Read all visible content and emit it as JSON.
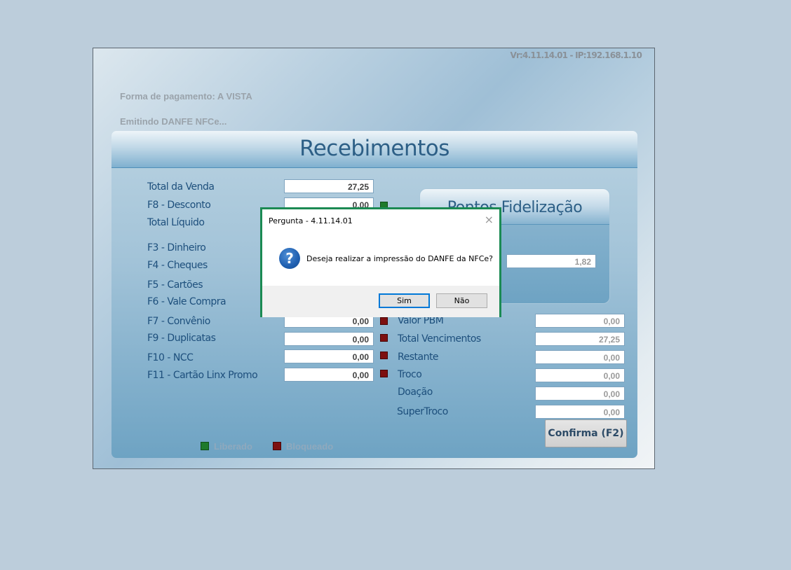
{
  "window": {
    "version": "Vr:4.11.14.01 - IP:192.168.1.10",
    "payment_method": "Forma de pagamento: A VISTA",
    "status": "Emitindo DANFE NFCe..."
  },
  "panel": {
    "title": "Recebimentos"
  },
  "left_fields": [
    {
      "label": "Total da Venda",
      "value": "27,25"
    },
    {
      "label": "F8 - Desconto",
      "value": "0,00"
    },
    {
      "label": "Total Líquido",
      "value": ""
    },
    {
      "label": "F3 - Dinheiro",
      "value": ""
    },
    {
      "label": "F4 - Cheques",
      "value": ""
    },
    {
      "label": "F5 - Cartões",
      "value": ""
    },
    {
      "label": "F6 - Vale Compra",
      "value": ""
    },
    {
      "label": "F7 - Convênio",
      "value": "0,00"
    },
    {
      "label": "F9 - Duplicatas",
      "value": "0,00"
    },
    {
      "label": "F10 - NCC",
      "value": "0,00"
    },
    {
      "label": "F11 - Cartão Linx Promo",
      "value": "0,00"
    }
  ],
  "pontos": {
    "title": "Pontos Fidelização",
    "value": "1,82"
  },
  "right_fields": [
    {
      "label": "Valor PBM",
      "value": "0,00"
    },
    {
      "label": "Total Vencimentos",
      "value": "27,25"
    },
    {
      "label": "Restante",
      "value": "0,00"
    },
    {
      "label": "Troco",
      "value": "0,00"
    },
    {
      "label": "Doação",
      "value": "0,00"
    },
    {
      "label": "SuperTroco",
      "value": "0,00"
    }
  ],
  "confirm_button": "Confirma (F2)",
  "legend": {
    "liberado": "Liberado",
    "bloqueado": "Bloqueado"
  },
  "colors": {
    "liberado": "#1e7a2c",
    "bloqueado": "#7d1010",
    "dialog_border": "#1b8a53"
  },
  "dialog": {
    "title": "Pergunta - 4.11.14.01",
    "close_icon": "×",
    "icon": "question-icon",
    "icon_glyph": "?",
    "message": "Deseja realizar a impressão do DANFE da NFCe?",
    "yes": "Sim",
    "no": "Não"
  }
}
